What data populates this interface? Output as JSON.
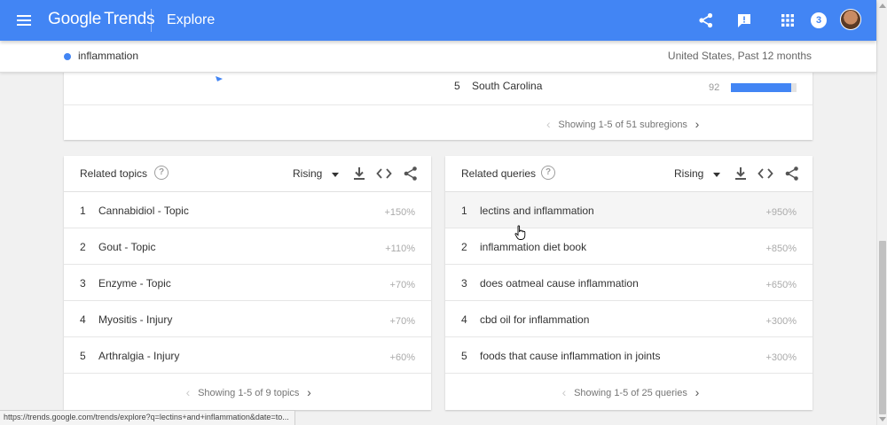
{
  "app": {
    "logo_google": "Google",
    "logo_trends": "Trends",
    "section": "Explore",
    "notification_count": "3"
  },
  "subbar": {
    "term": "inflammation",
    "scope": "United States, Past 12 months",
    "term_color": "#4285f4"
  },
  "region": {
    "row": {
      "rank": "5",
      "name": "South Carolina",
      "value": "92",
      "fraction": 0.92
    },
    "pager": "Showing 1-5 of 51 subregions"
  },
  "topics": {
    "title": "Related topics",
    "filter": "Rising",
    "rows": [
      {
        "rank": "1",
        "label": "Cannabidiol - Topic",
        "value": "+150%"
      },
      {
        "rank": "2",
        "label": "Gout - Topic",
        "value": "+110%"
      },
      {
        "rank": "3",
        "label": "Enzyme - Topic",
        "value": "+70%"
      },
      {
        "rank": "4",
        "label": "Myositis - Injury",
        "value": "+70%"
      },
      {
        "rank": "5",
        "label": "Arthralgia - Injury",
        "value": "+60%"
      }
    ],
    "pager": "Showing 1-5 of 9 topics"
  },
  "queries": {
    "title": "Related queries",
    "filter": "Rising",
    "rows": [
      {
        "rank": "1",
        "label": "lectins and inflammation",
        "value": "+950%"
      },
      {
        "rank": "2",
        "label": "inflammation diet book",
        "value": "+850%"
      },
      {
        "rank": "3",
        "label": "does oatmeal cause inflammation",
        "value": "+650%"
      },
      {
        "rank": "4",
        "label": "cbd oil for inflammation",
        "value": "+300%"
      },
      {
        "rank": "5",
        "label": "foods that cause inflammation in joints",
        "value": "+300%"
      }
    ],
    "pager": "Showing 1-5 of 25 queries"
  },
  "icons": {
    "menu": "hamburger-menu-icon",
    "share": "share-icon",
    "feedback": "feedback-icon",
    "apps": "apps-grid-icon",
    "help": "help-circle-icon",
    "download": "download-icon",
    "embed": "embed-code-icon",
    "dropdown": "caret-down-icon",
    "prev": "chevron-left-icon",
    "next": "chevron-right-icon"
  },
  "colors": {
    "brand": "#4285f4"
  },
  "statusbar": {
    "url": "https://trends.google.com/trends/explore?q=lectins+and+inflammation&date=to..."
  }
}
